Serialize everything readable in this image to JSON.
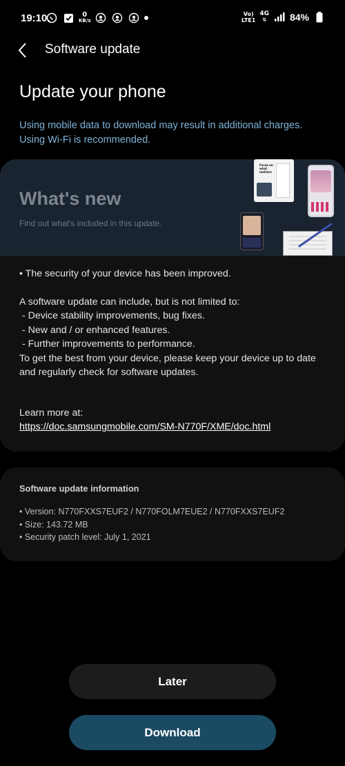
{
  "status_bar": {
    "time": "19:10",
    "net_speed_value": "0",
    "net_speed_unit": "KB/s",
    "volte_top": "Vo)",
    "volte_bottom": "LTE1",
    "network_type": "4G",
    "battery_percent": "84%"
  },
  "header": {
    "title": "Software update"
  },
  "page": {
    "title": "Update your phone",
    "data_notice": "Using mobile data to download may result in additional charges. Using Wi-Fi is recommended."
  },
  "whats_new": {
    "title": "What's new",
    "subtitle": "Find out what's included in this update.",
    "illustration_text": "Focus on what matters",
    "notes": [
      "• The security of your device has been improved.",
      "",
      "A software update can include, but is not limited to:",
      " - Device stability improvements, bug fixes.",
      " - New and / or enhanced features.",
      " - Further improvements to performance.",
      "To get the best from your device, please keep your device up to date",
      "and regularly check for software updates."
    ],
    "learn_more_label": "Learn more at:",
    "learn_more_url": "https://doc.samsungmobile.com/SM-N770F/XME/doc.html"
  },
  "update_info": {
    "title": "Software update information",
    "items": [
      "• Version: N770FXXS7EUF2 / N770FOLM7EUE2 / N770FXXS7EUF2",
      "• Size: 143.72 MB",
      "• Security patch level: July 1, 2021"
    ]
  },
  "buttons": {
    "later": "Later",
    "download": "Download"
  },
  "colors": {
    "background": "#000000",
    "notice_text": "#7fb3d9",
    "banner_bg": "#1a2431",
    "card_bg": "#111111",
    "download_button": "#1b4a63",
    "later_button": "#1c1c1c"
  }
}
